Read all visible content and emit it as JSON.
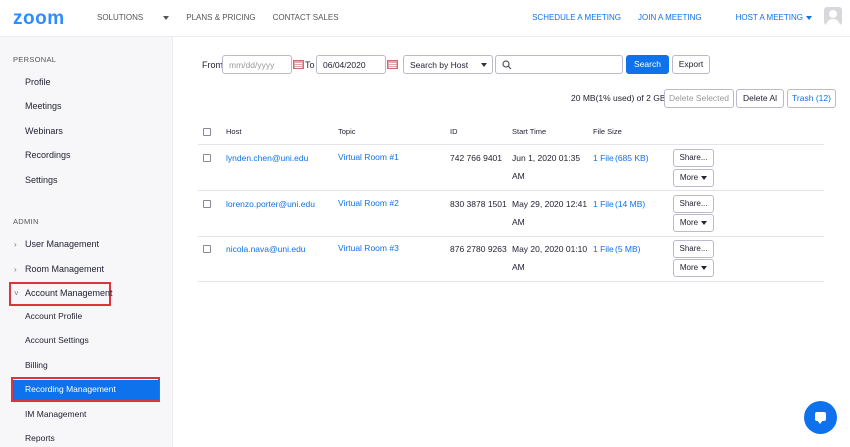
{
  "header": {
    "logo": "zoom",
    "nav_left": [
      "SOLUTIONS",
      "PLANS & PRICING",
      "CONTACT SALES"
    ],
    "nav_right": [
      "SCHEDULE A MEETING",
      "JOIN A MEETING",
      "HOST A MEETING"
    ]
  },
  "sidebar": {
    "personal_title": "PERSONAL",
    "personal_items": [
      "Profile",
      "Meetings",
      "Webinars",
      "Recordings",
      "Settings"
    ],
    "admin_title": "ADMIN",
    "admin_groups": [
      "User Management",
      "Room Management",
      "Account Management"
    ],
    "account_items": [
      "Account Profile",
      "Account Settings",
      "Billing",
      "Recording Management",
      "IM Management",
      "Reports"
    ]
  },
  "filters": {
    "from_label": "From",
    "from_placeholder": "mm/dd/yyyy",
    "to_label": "To",
    "to_value": "06/04/2020",
    "search_by": "Search by  Host",
    "search_button": "Search",
    "export_button": "Export"
  },
  "storage": {
    "usage_text": "20 MB(1% used) of 2 GB",
    "delete_selected": "Delete Selected",
    "delete_all": "Delete Al",
    "trash": "Trash (12)"
  },
  "table": {
    "headers": [
      "Host",
      "Topic",
      "ID",
      "Start Time",
      "File Size"
    ],
    "rows": [
      {
        "host": "lynden.chen@uni.edu",
        "topic": "Virtual Room #1",
        "id": "742 766 9401",
        "start": "Jun 1, 2020 01:35 AM",
        "files": "1 File",
        "size": "(685 KB)"
      },
      {
        "host": "lorenzo.porter@uni.edu",
        "topic": "Virtual Room #2",
        "id": "830 3878 1501",
        "start": "May 29, 2020 12:41 AM",
        "files": "1 File",
        "size": "(14 MB)"
      },
      {
        "host": "nicola.nava@uni.edu",
        "topic": "Virtual Room #3",
        "id": "876 2780 9263",
        "start": "May 20, 2020 01:10 AM",
        "files": "1 File",
        "size": "(5 MB)"
      }
    ],
    "share_label": "Share...",
    "more_label": "More"
  },
  "colors": {
    "accent": "#0e72ed",
    "highlight_box": "#d9363e"
  }
}
